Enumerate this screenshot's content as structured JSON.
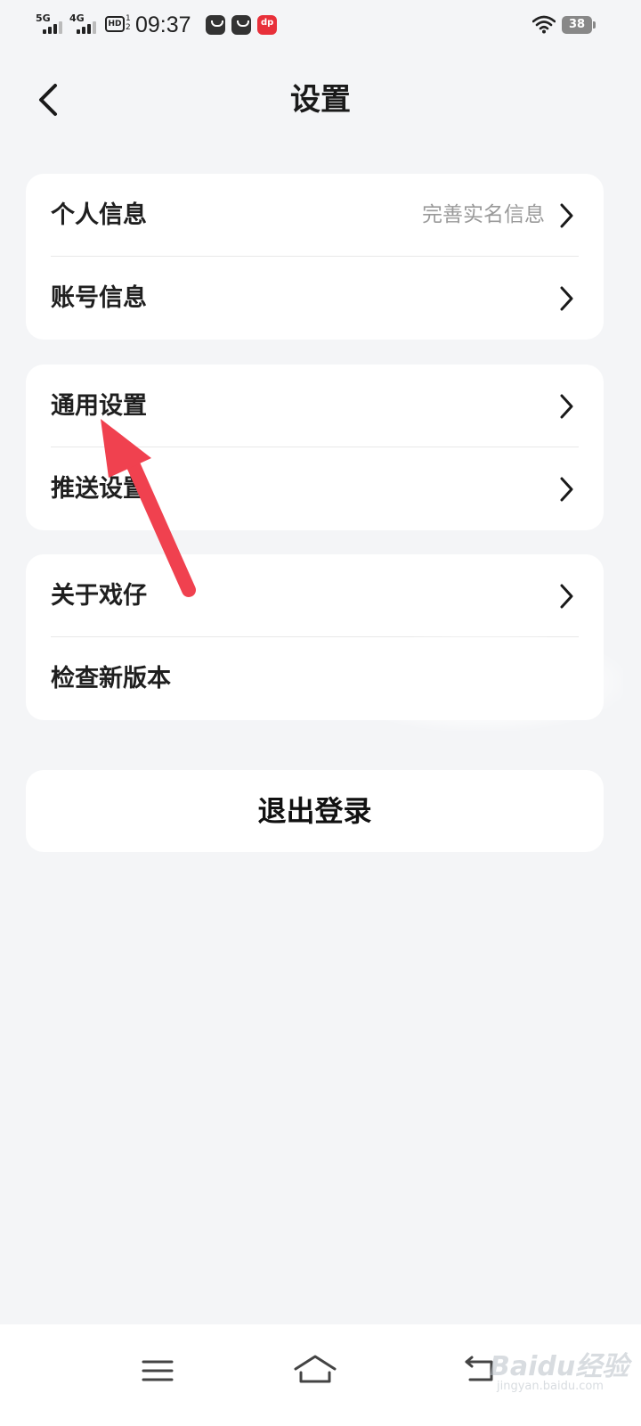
{
  "status_bar": {
    "network_1": "5G",
    "network_2": "4G",
    "hd_label": "HD",
    "hd_sub_1": "1",
    "hd_sub_2": "2",
    "time": "09:37",
    "battery": "38",
    "icons": [
      "signal-icon",
      "hd-icon",
      "notification-icon",
      "notification-icon",
      "dianping-app-icon",
      "wifi-icon",
      "battery-icon"
    ]
  },
  "header": {
    "title": "设置",
    "back_icon": "chevron-left-icon"
  },
  "groups": {
    "account": {
      "personal_info": {
        "label": "个人信息",
        "hint": "完善实名信息"
      },
      "account_info": {
        "label": "账号信息"
      }
    },
    "settings": {
      "general": {
        "label": "通用设置"
      },
      "push": {
        "label": "推送设置"
      }
    },
    "about": {
      "about_app": {
        "label": "关于戏仔"
      },
      "check_update": {
        "label": "检查新版本"
      }
    }
  },
  "logout": {
    "label": "退出登录"
  },
  "annotation": {
    "color": "#f0414f",
    "icon": "arrow-icon"
  },
  "nav_bar": {
    "icons": [
      "menu-icon",
      "home-icon",
      "back-icon"
    ]
  },
  "watermark": {
    "text": "Baidu经验",
    "sub": "jingyan.baidu.com"
  },
  "colors": {
    "background": "#f4f5f7",
    "card": "#ffffff",
    "hint_text": "#9a9a9a",
    "divider": "#e8e8e8"
  }
}
